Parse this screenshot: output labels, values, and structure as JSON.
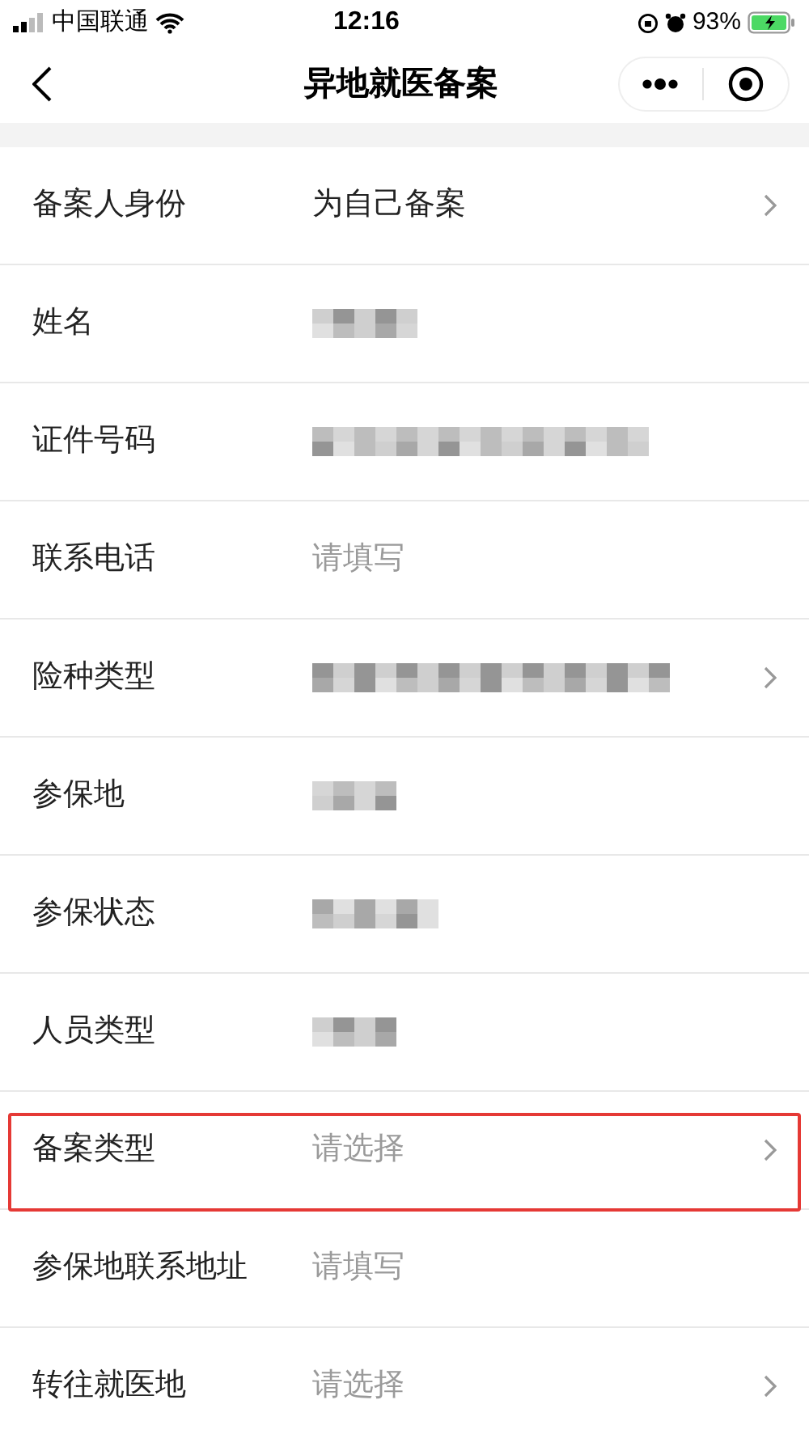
{
  "status_bar": {
    "carrier": "中国联通",
    "time": "12:16",
    "battery": "93%",
    "charging": true
  },
  "nav": {
    "title": "异地就医备案"
  },
  "rows": [
    {
      "label": "备案人身份",
      "kind": "value",
      "value": "为自己备案",
      "chevron": true,
      "highlighted": false
    },
    {
      "label": "姓名",
      "kind": "redacted",
      "chevron": false,
      "highlighted": false
    },
    {
      "label": "证件号码",
      "kind": "redacted",
      "chevron": false,
      "highlighted": false
    },
    {
      "label": "联系电话",
      "kind": "placeholder",
      "placeholder": "请填写",
      "chevron": false,
      "highlighted": false
    },
    {
      "label": "险种类型",
      "kind": "redacted",
      "chevron": true,
      "highlighted": false
    },
    {
      "label": "参保地",
      "kind": "redacted",
      "chevron": false,
      "highlighted": false
    },
    {
      "label": "参保状态",
      "kind": "redacted",
      "chevron": false,
      "highlighted": false
    },
    {
      "label": "人员类型",
      "kind": "redacted",
      "chevron": false,
      "highlighted": false
    },
    {
      "label": "备案类型",
      "kind": "placeholder",
      "placeholder": "请选择",
      "chevron": true,
      "highlighted": true
    },
    {
      "label": "参保地联系地址",
      "kind": "placeholder",
      "placeholder": "请填写",
      "chevron": false,
      "highlighted": false
    },
    {
      "label": "转往就医地",
      "kind": "placeholder",
      "placeholder": "请选择",
      "chevron": true,
      "highlighted": false
    }
  ]
}
